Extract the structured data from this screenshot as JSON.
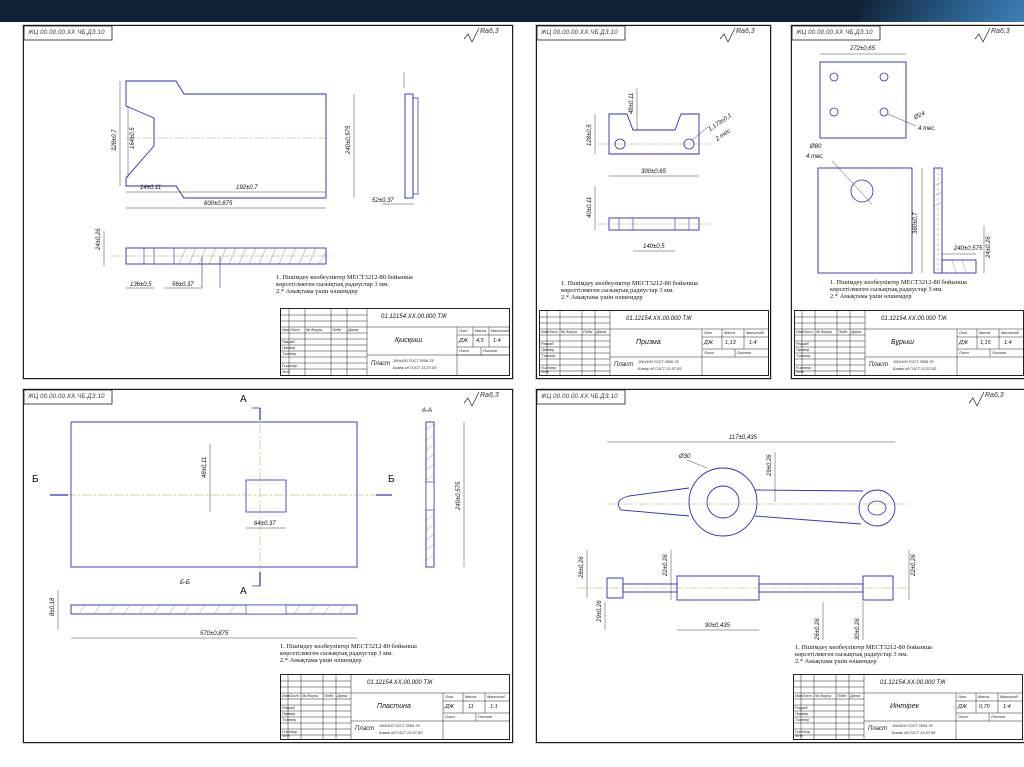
{
  "stamp": "ЖЦ 00.00.00.XX.ЧБ.ДЗ.10",
  "roughness": "Ra6,3",
  "notes": {
    "line1": "1. Пішімдеу көлбеуліктер МЕСТ3212-80 бойынша",
    "line2": "көрсетілмеген сызықтық радиустар 3 мм.",
    "line3": "2.* Анықтама үшін өлшемдер"
  },
  "title_block": {
    "head_labels": [
      "Изм",
      "Лист",
      "№ докум.",
      "Подп.",
      "Дата"
    ],
    "roles": [
      "Разраб",
      "Провер",
      "Т.контр",
      "Н.контр",
      "Утв"
    ],
    "col_labels": [
      "Лит.",
      "Масса",
      "Масштаб"
    ],
    "sheet_label": "Лист",
    "sheets_label": "Листов",
    "material_sub": "Бланк чЛ ГОСТ 23-57-83"
  },
  "drawings": [
    {
      "code": "01.12154.XX.00.000 ТЖ",
      "name": "Қысқыш",
      "material": "Пласт",
      "material_detail": "100x100 ГОСТ 3559-78",
      "mass": "4,5",
      "scale": "1:4",
      "dims": [
        "328±0,7",
        "164±0,5",
        "14±0,11",
        "192±0,7",
        "600±0,875",
        "240±0,575",
        "52±0,37",
        "24±0,26",
        "136±0,5",
        "56±0,37"
      ]
    },
    {
      "code": "01.12154.XX.00.000 ТЖ",
      "name": "Призма",
      "material": "Пласт",
      "material_detail": "100x100 ГОСТ 3559-78",
      "mass": "1,13",
      "scale": "1:4",
      "dims": [
        "128±0,5",
        "48±0,11",
        "1,173±0,1",
        "2 тес.",
        "300±0,65",
        "40±0,11",
        "140±0,5"
      ]
    },
    {
      "code": "01.12154.XX.00.000 ТЖ",
      "name": "Бұрыш",
      "material": "Пласт",
      "material_detail": "100x100 ГОСТ 3559-78",
      "mass": "1,15",
      "scale": "1:4",
      "dims": [
        "272±0,65",
        "Ø24",
        "4 тес.",
        "Ø80",
        "4 тес.",
        "360±0,7",
        "240±0,575",
        "24±0,26"
      ]
    },
    {
      "code": "01.12154.XX.00.000 ТЖ",
      "name": "Пластина",
      "material": "Пласт",
      "material_detail": "100x100 ГОСТ 3559-78",
      "mass": "11",
      "scale": "1:1",
      "section_letters": [
        "А",
        "А",
        "Б",
        "Б",
        "А-А",
        "Б-Б"
      ],
      "dims": [
        "48±0,11",
        "64±0,37",
        "240±0,575",
        "8±0,18",
        "570±0,875"
      ]
    },
    {
      "code": "01.12154.XX.00.000 ТЖ",
      "name": "Иінтірек",
      "material": "Пласт",
      "material_detail": "100x100 ГОСТ 3559-78",
      "mass": "0,70",
      "scale": "1:4",
      "dims": [
        "117±0,435",
        "Ø30",
        "29±0,26",
        "28±0,26",
        "22±0,26",
        "22±0,26",
        "29±0,26",
        "90±0,435",
        "26±0,26",
        "30±0,26"
      ]
    }
  ]
}
